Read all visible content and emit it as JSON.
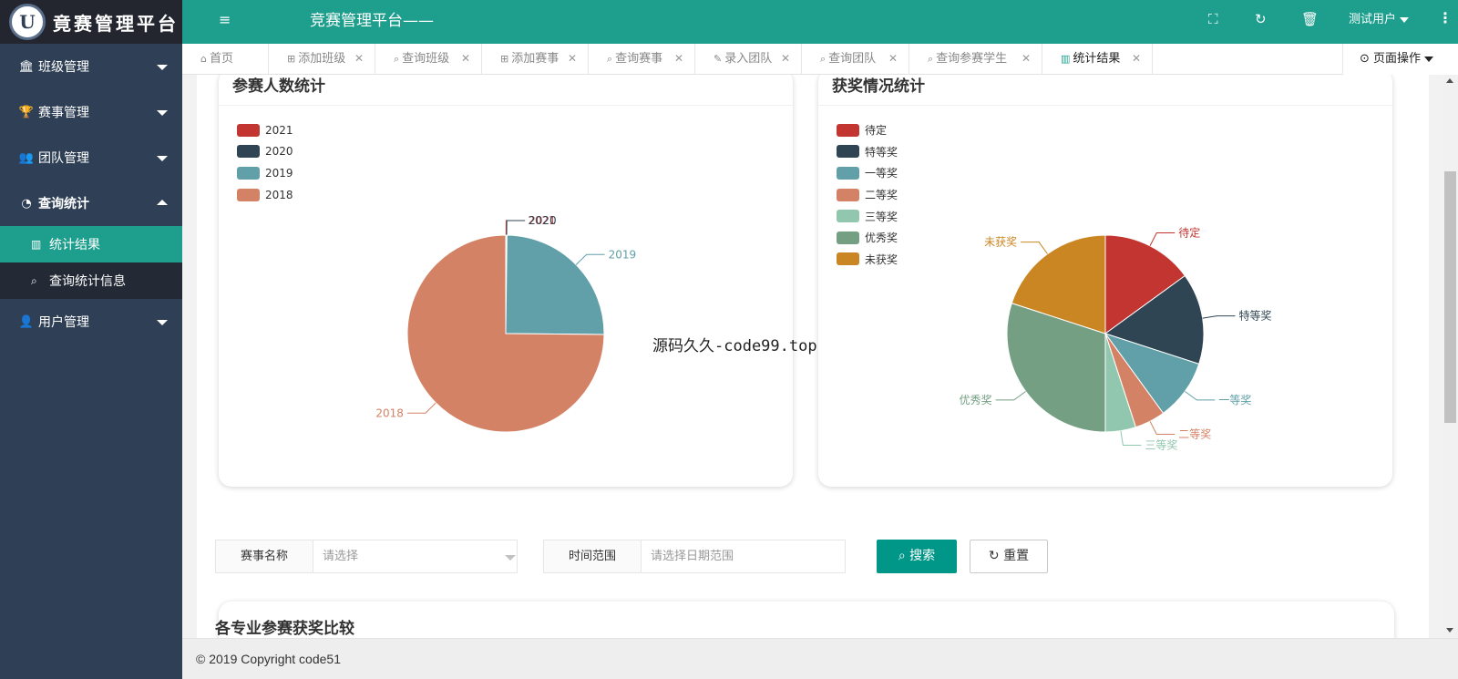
{
  "app": {
    "logo_letter": "U",
    "logo_text": "竟赛管理平台",
    "header_title": "竞赛管理平台——"
  },
  "header": {
    "user_name": "测试用户",
    "menu_icon": "≡",
    "fullscreen_icon": "⛶",
    "refresh_icon": "↻",
    "clear_icon": "🗑",
    "more_icon": "⋮"
  },
  "sidebar": {
    "items": [
      {
        "label": "班级管理",
        "icon": "🏛"
      },
      {
        "label": "赛事管理",
        "icon": "🏆"
      },
      {
        "label": "团队管理",
        "icon": "👥"
      },
      {
        "label": "查询统计",
        "icon": "◔"
      }
    ],
    "sub_items": [
      {
        "label": "统计结果",
        "icon": "▥"
      },
      {
        "label": "查询统计信息",
        "icon": "⌕"
      }
    ],
    "user_mgmt": {
      "label": "用户管理",
      "icon": "👤"
    }
  },
  "tabs": [
    {
      "label": "首页",
      "icon": "⌂"
    },
    {
      "label": "添加班级",
      "icon": "⊞"
    },
    {
      "label": "查询班级",
      "icon": "⌕"
    },
    {
      "label": "添加赛事",
      "icon": "⊞"
    },
    {
      "label": "查询赛事",
      "icon": "⌕"
    },
    {
      "label": "录入团队",
      "icon": "✎"
    },
    {
      "label": "查询团队",
      "icon": "⌕"
    },
    {
      "label": "查询参赛学生",
      "icon": "⌕"
    },
    {
      "label": "统计结果",
      "icon": "▥"
    }
  ],
  "page_ops": {
    "label": "页面操作",
    "icon": "⊙"
  },
  "charts": {
    "participants_title": "参赛人数统计",
    "awards_title": "获奖情况统计"
  },
  "chart_data": [
    {
      "type": "pie",
      "title": "参赛人数统计",
      "labels": [
        "2021",
        "2020",
        "2019",
        "2018"
      ],
      "values": [
        0.1,
        0.1,
        25,
        75
      ],
      "colors": [
        "#c23531",
        "#2f4554",
        "#61a0a8",
        "#d48265"
      ],
      "legend": "top-left"
    },
    {
      "type": "pie",
      "title": "获奖情况统计",
      "labels": [
        "待定",
        "特等奖",
        "一等奖",
        "二等奖",
        "三等奖",
        "优秀奖",
        "未获奖"
      ],
      "values": [
        3,
        3,
        2,
        1,
        1,
        6,
        4
      ],
      "colors": [
        "#c23531",
        "#2f4554",
        "#61a0a8",
        "#d48265",
        "#91c7ae",
        "#749f83",
        "#ca8622"
      ],
      "legend": "top-left"
    }
  ],
  "watermark": "源码久久-code99.top",
  "search": {
    "event_label": "赛事名称",
    "event_placeholder": "请选择",
    "time_label": "时间范围",
    "time_placeholder": "请选择日期范围",
    "search_button": "搜索",
    "search_icon": "⌕",
    "reset_button": "重置",
    "reset_icon": "↻"
  },
  "bottom_card_title": "各专业参赛获奖比较",
  "footer": {
    "copyright": "© 2019 Copyright code51"
  },
  "colors": {
    "header": "#1e9f8e",
    "sidebar": "#2f4056",
    "active": "#1e9f8e",
    "button": "#009688"
  }
}
